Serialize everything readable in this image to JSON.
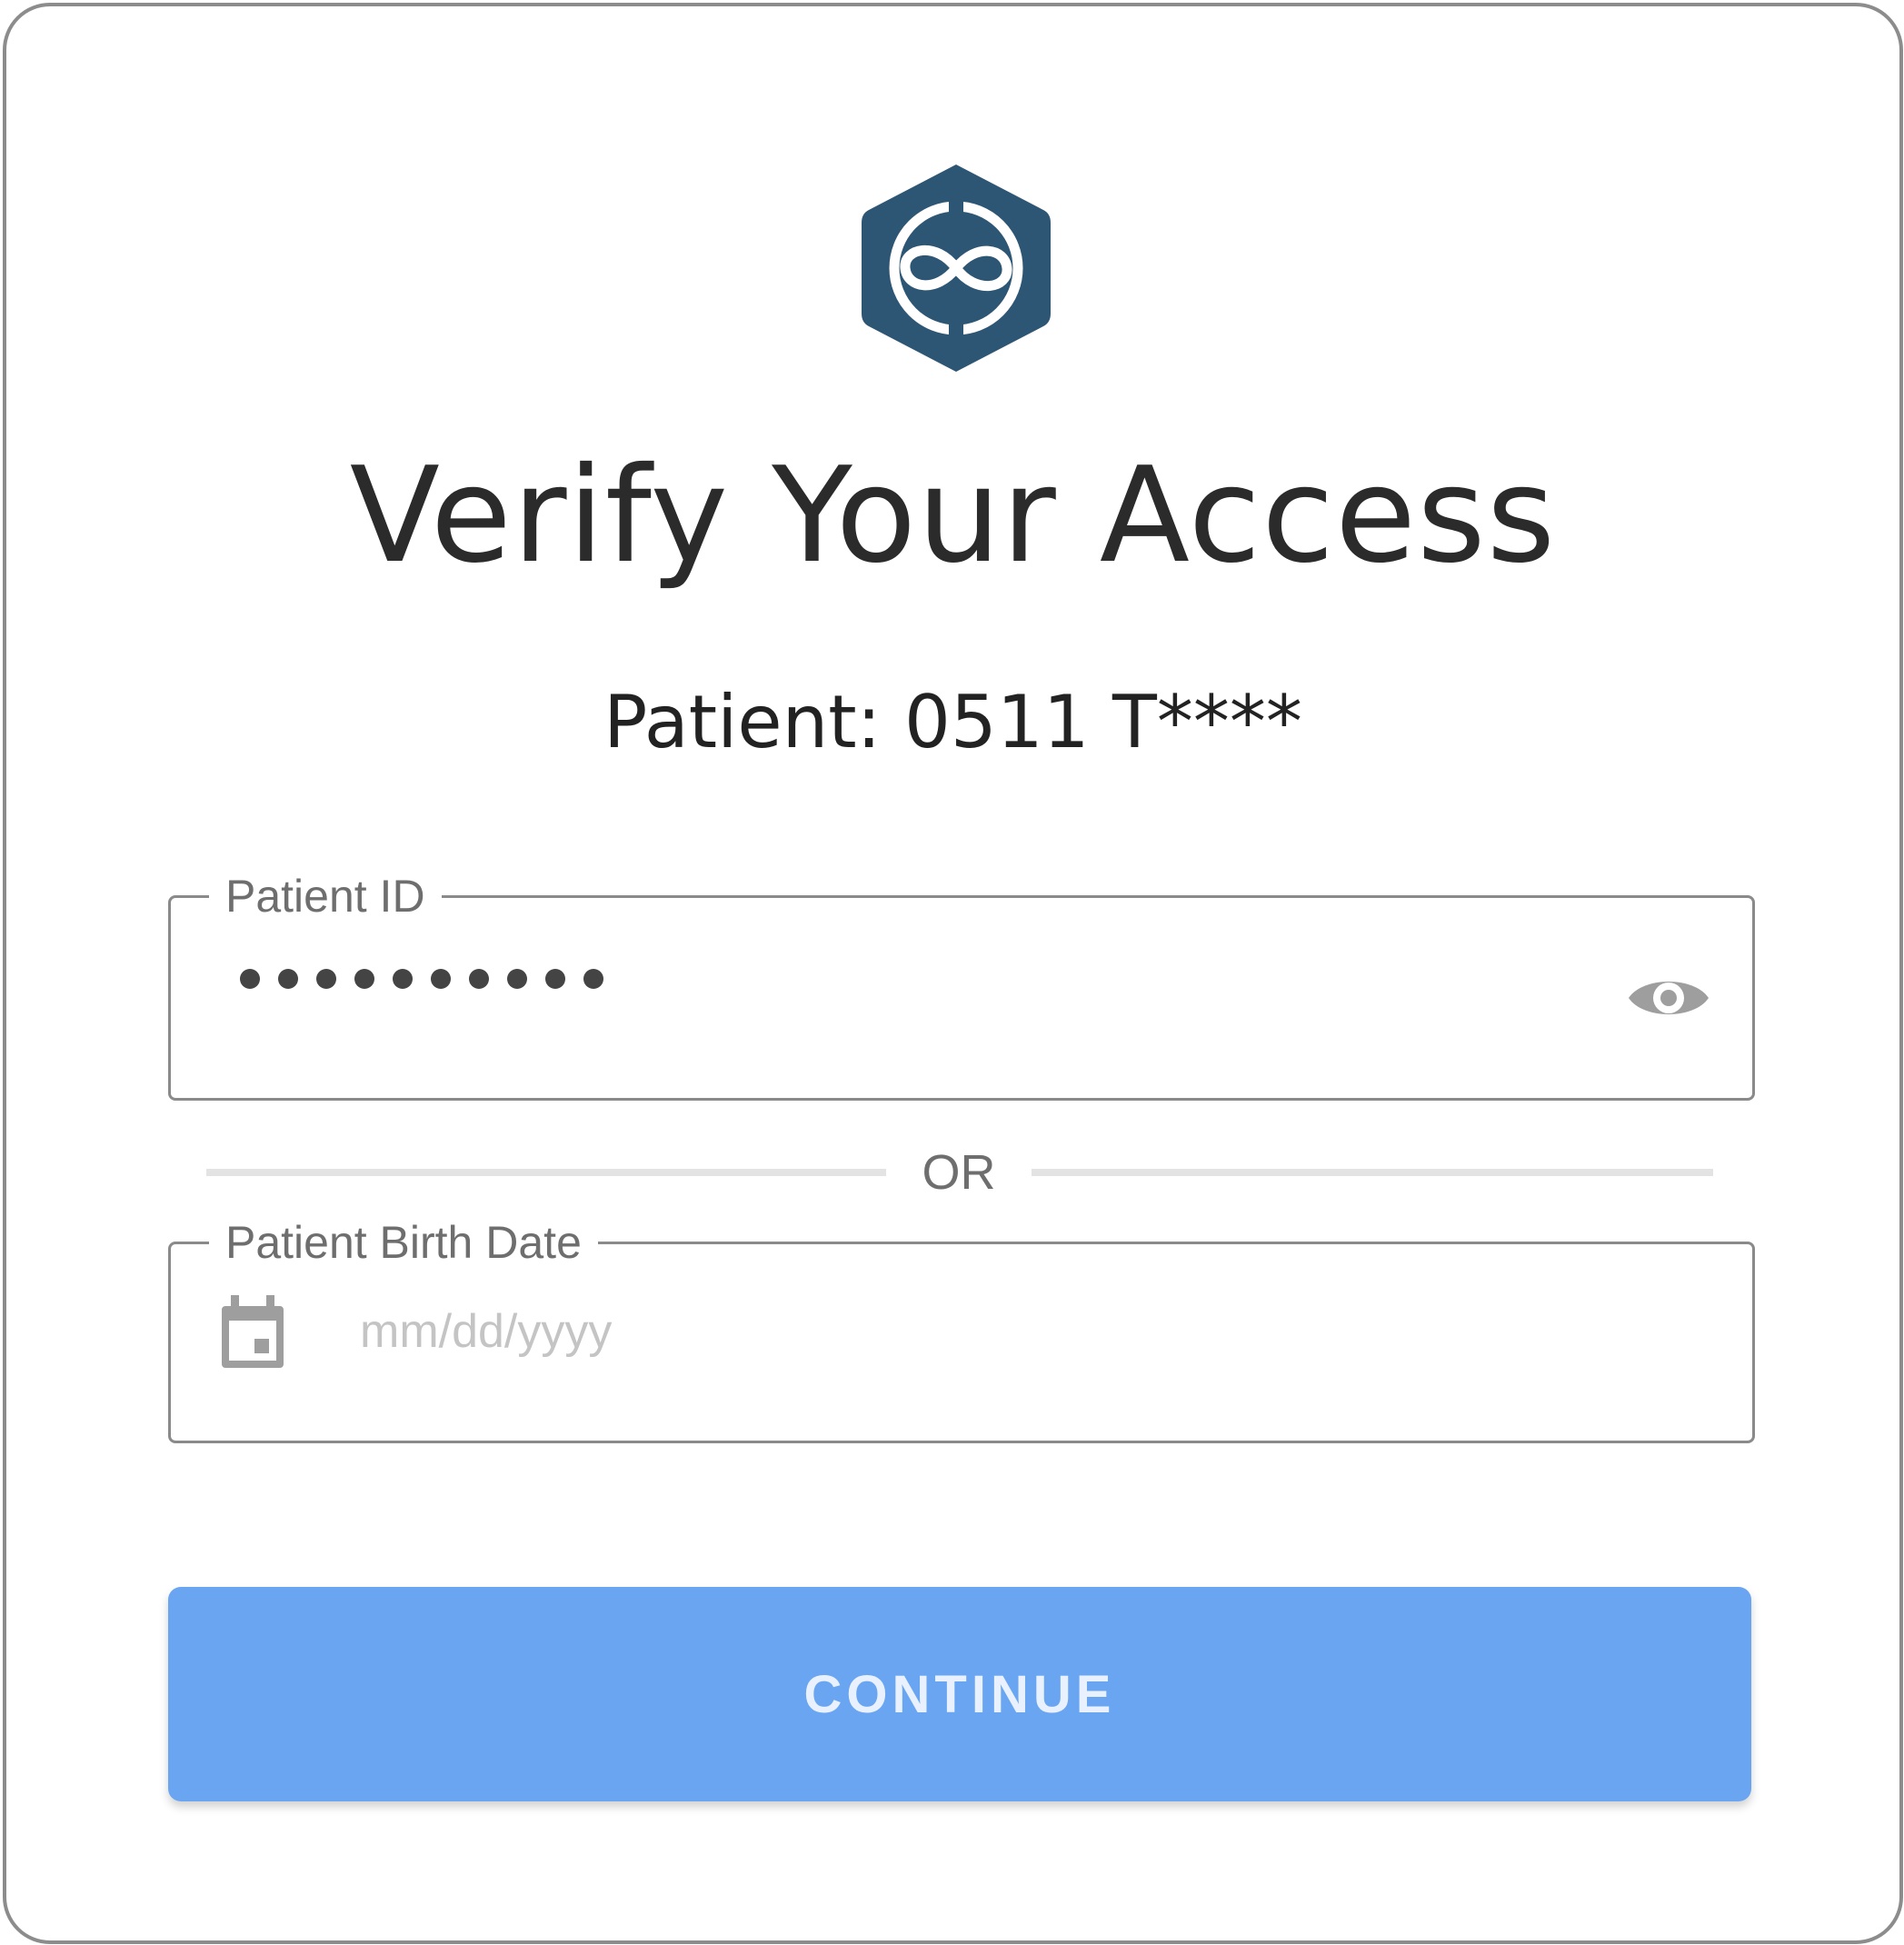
{
  "header": {
    "logo_icon": "infinity-hexagon-logo",
    "title": "Verify Your Access",
    "patient_line": "Patient: 0511 T****"
  },
  "patient_id_field": {
    "label": "Patient ID",
    "masked_value_length": 10,
    "toggle_icon": "eye-icon"
  },
  "divider": {
    "text": "OR"
  },
  "birth_date_field": {
    "label": "Patient Birth Date",
    "placeholder": "mm/dd/yyyy",
    "icon": "calendar-icon"
  },
  "actions": {
    "continue_label": "CONTINUE"
  },
  "colors": {
    "brand": "#2d5574",
    "button": "#6aa5f2",
    "border": "#8a8a8a"
  }
}
